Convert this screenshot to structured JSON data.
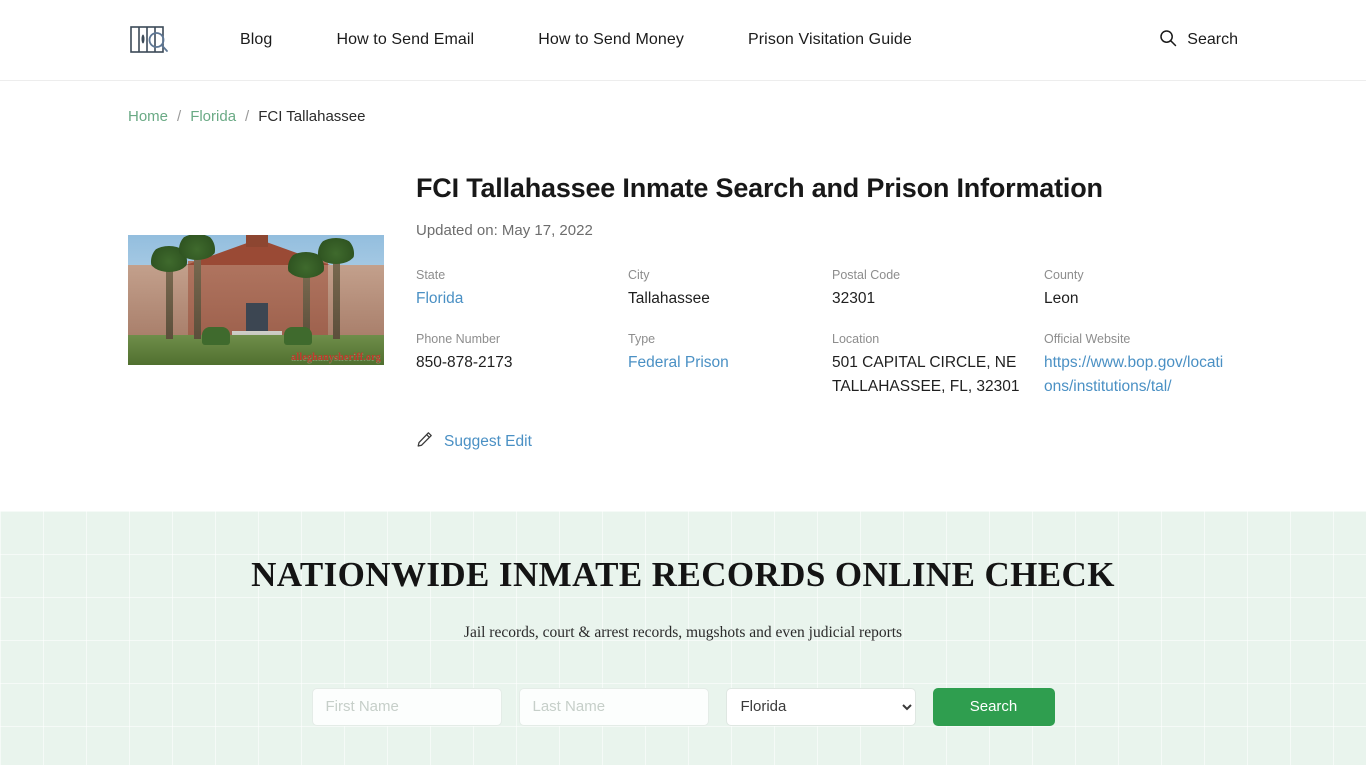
{
  "header": {
    "logo_icon": "prison-bars-magnifier-logo",
    "nav": [
      {
        "label": "Blog"
      },
      {
        "label": "How to Send Email"
      },
      {
        "label": "How to Send Money"
      },
      {
        "label": "Prison Visitation Guide"
      }
    ],
    "search": {
      "icon": "search-icon",
      "label": "Search"
    }
  },
  "breadcrumb": {
    "home": "Home",
    "sep1": "/",
    "state": "Florida",
    "sep2": "/",
    "current": "FCI Tallahassee"
  },
  "main": {
    "image_watermark": "alleghanysheriff.org",
    "title": "FCI Tallahassee Inmate Search and Prison Information",
    "updated": "Updated on: May 17, 2022",
    "facts": {
      "state_label": "State",
      "state_value": "Florida",
      "city_label": "City",
      "city_value": "Tallahassee",
      "postal_label": "Postal Code",
      "postal_value": "32301",
      "county_label": "County",
      "county_value": "Leon",
      "phone_label": "Phone Number",
      "phone_value": "850-878-2173",
      "type_label": "Type",
      "type_value": "Federal Prison",
      "location_label": "Location",
      "location_line1": "501 CAPITAL CIRCLE, NE",
      "location_line2": "TALLAHASSEE, FL, 32301",
      "website_label": "Official Website",
      "website_value": "https://www.bop.gov/locations/institutions/tal/"
    },
    "suggest_edit": {
      "icon": "pencil-icon",
      "label": "Suggest Edit"
    }
  },
  "band": {
    "title": "NATIONWIDE INMATE RECORDS ONLINE CHECK",
    "subtitle": "Jail records, court & arrest records, mugshots and even judicial reports",
    "first_name_placeholder": "First Name",
    "first_name_value": "",
    "last_name_placeholder": "Last Name",
    "last_name_value": "",
    "state_selected": "Florida",
    "search_button": "Search"
  },
  "colors": {
    "accent_green": "#2f9e4f",
    "band_bg": "#e9f4ed",
    "link_blue": "#4a90c4",
    "breadcrumb_green": "#6aaa85"
  }
}
